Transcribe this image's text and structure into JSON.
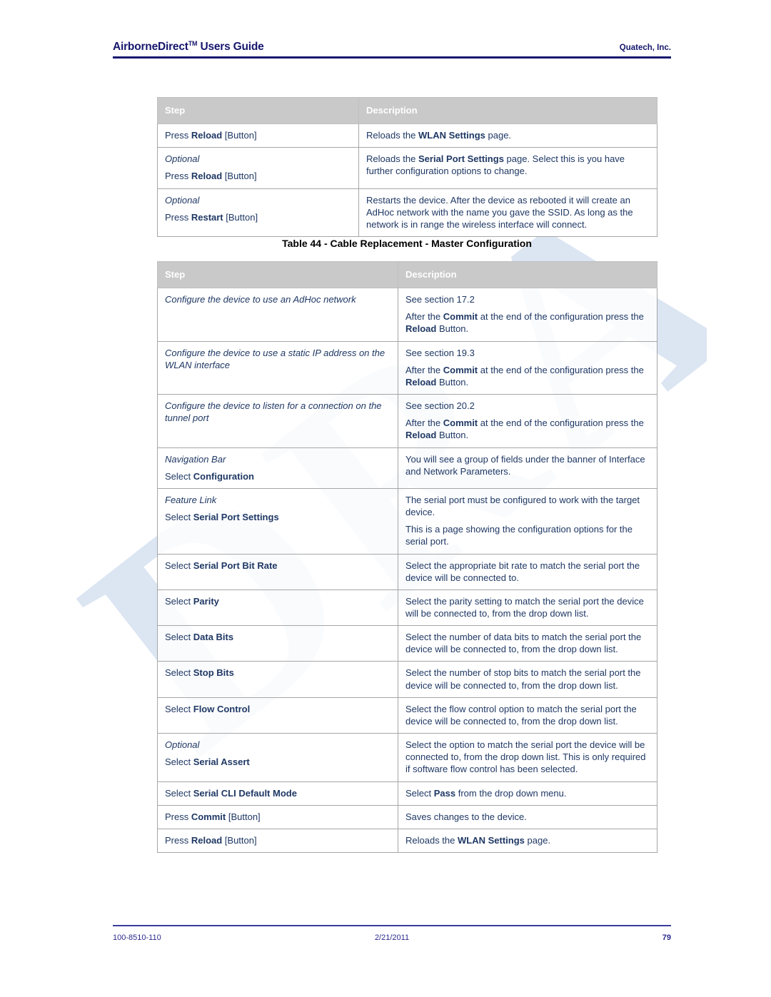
{
  "header": {
    "doc_title": "AirborneDirect",
    "doc_title_tm": "TM",
    "doc_title_rest": " Users Guide",
    "company": "Quatech, Inc."
  },
  "watermark": {
    "text": "DRAFT"
  },
  "footer": {
    "doc_number": "100-8510-110",
    "date": "2/21/2011",
    "page_number": "79"
  },
  "table_top": {
    "columns": [
      "Step",
      "Description"
    ],
    "rows": [
      {
        "step_lines": [
          [
            {
              "t": "Press ",
              "b": false,
              "i": false
            },
            {
              "t": "Reload",
              "b": true,
              "i": false
            },
            {
              "t": " [Button]",
              "b": false,
              "i": false
            }
          ]
        ],
        "desc_lines": [
          [
            {
              "t": "Reloads the ",
              "b": false,
              "i": false
            },
            {
              "t": "WLAN Settings",
              "b": true,
              "i": false
            },
            {
              "t": " page.",
              "b": false,
              "i": false
            }
          ]
        ]
      },
      {
        "step_lines": [
          [
            {
              "t": "Optional",
              "b": false,
              "i": true
            }
          ],
          [
            {
              "t": "Press ",
              "b": false,
              "i": false
            },
            {
              "t": "Reload",
              "b": true,
              "i": false
            },
            {
              "t": " [Button]",
              "b": false,
              "i": false
            }
          ]
        ],
        "desc_lines": [
          [
            {
              "t": "Reloads the ",
              "b": false,
              "i": false
            },
            {
              "t": "Serial Port Settings",
              "b": true,
              "i": false
            },
            {
              "t": " page. Select this is you have further configuration options to change.",
              "b": false,
              "i": false
            }
          ]
        ]
      },
      {
        "step_lines": [
          [
            {
              "t": "Optional",
              "b": false,
              "i": true
            }
          ],
          [
            {
              "t": "Press ",
              "b": false,
              "i": false
            },
            {
              "t": "Restart",
              "b": true,
              "i": false
            },
            {
              "t": " [Button]",
              "b": false,
              "i": false
            }
          ]
        ],
        "desc_lines": [
          [
            {
              "t": "Restarts the device. After the device as rebooted it will create an AdHoc network with the name you gave the SSID. As long as the network is in range the wireless interface will connect.",
              "b": false,
              "i": false
            }
          ]
        ]
      }
    ]
  },
  "table_44": {
    "caption": "Table 44 - Cable Replacement - Master Configuration",
    "columns": [
      "Step",
      "Description"
    ],
    "rows": [
      {
        "step_lines": [
          [
            {
              "t": "Configure the device to use an AdHoc network",
              "b": false,
              "i": true
            }
          ]
        ],
        "desc_lines": [
          [
            {
              "t": "See section 17.2",
              "b": false,
              "i": false
            }
          ],
          [
            {
              "t": "After the ",
              "b": false,
              "i": false
            },
            {
              "t": "Commit",
              "b": true,
              "i": false
            },
            {
              "t": " at the end of the configuration press the ",
              "b": false,
              "i": false
            },
            {
              "t": "Reload",
              "b": true,
              "i": false
            },
            {
              "t": " Button.",
              "b": false,
              "i": false
            }
          ]
        ]
      },
      {
        "step_lines": [
          [
            {
              "t": "Configure the device to use a static IP address on the WLAN interface",
              "b": false,
              "i": true
            }
          ]
        ],
        "desc_lines": [
          [
            {
              "t": "See section 19.3",
              "b": false,
              "i": false
            }
          ],
          [
            {
              "t": "After the ",
              "b": false,
              "i": false
            },
            {
              "t": "Commit",
              "b": true,
              "i": false
            },
            {
              "t": " at the end of the configuration press the ",
              "b": false,
              "i": false
            },
            {
              "t": "Reload",
              "b": true,
              "i": false
            },
            {
              "t": " Button.",
              "b": false,
              "i": false
            }
          ]
        ]
      },
      {
        "step_lines": [
          [
            {
              "t": "Configure the device to listen for a connection on the tunnel port",
              "b": false,
              "i": true
            }
          ]
        ],
        "desc_lines": [
          [
            {
              "t": "See section 20.2",
              "b": false,
              "i": false
            }
          ],
          [
            {
              "t": "After the ",
              "b": false,
              "i": false
            },
            {
              "t": "Commit",
              "b": true,
              "i": false
            },
            {
              "t": " at the end of the configuration press the ",
              "b": false,
              "i": false
            },
            {
              "t": "Reload",
              "b": true,
              "i": false
            },
            {
              "t": " Button.",
              "b": false,
              "i": false
            }
          ]
        ]
      },
      {
        "step_lines": [
          [
            {
              "t": "Navigation Bar",
              "b": false,
              "i": true
            }
          ],
          [
            {
              "t": "Select ",
              "b": false,
              "i": false
            },
            {
              "t": "Configuration",
              "b": true,
              "i": false
            }
          ]
        ],
        "desc_lines": [
          [
            {
              "t": "You will see a group of fields under the banner of Interface and Network Parameters.",
              "b": false,
              "i": false
            }
          ]
        ]
      },
      {
        "step_lines": [
          [
            {
              "t": "Feature Link",
              "b": false,
              "i": true
            }
          ],
          [
            {
              "t": "Select ",
              "b": false,
              "i": false
            },
            {
              "t": "Serial Port Settings",
              "b": true,
              "i": false
            }
          ]
        ],
        "desc_lines": [
          [
            {
              "t": "The serial port must be configured to work with the target device.",
              "b": false,
              "i": false
            }
          ],
          [
            {
              "t": "This is a page showing the configuration options for the serial port.",
              "b": false,
              "i": false
            }
          ]
        ]
      },
      {
        "step_lines": [
          [
            {
              "t": "Select ",
              "b": false,
              "i": false
            },
            {
              "t": "Serial Port Bit Rate",
              "b": true,
              "i": false
            }
          ]
        ],
        "desc_lines": [
          [
            {
              "t": "Select the appropriate bit rate to match the serial port the device will be connected to.",
              "b": false,
              "i": false
            }
          ]
        ]
      },
      {
        "step_lines": [
          [
            {
              "t": "Select ",
              "b": false,
              "i": false
            },
            {
              "t": "Parity",
              "b": true,
              "i": false
            }
          ]
        ],
        "desc_lines": [
          [
            {
              "t": "Select the parity setting to match the serial port the device will be connected to, from the drop down list.",
              "b": false,
              "i": false
            }
          ]
        ]
      },
      {
        "step_lines": [
          [
            {
              "t": "Select ",
              "b": false,
              "i": false
            },
            {
              "t": "Data Bits",
              "b": true,
              "i": false
            }
          ]
        ],
        "desc_lines": [
          [
            {
              "t": "Select the number of data bits to match the serial port the device will be connected to, from the drop down list.",
              "b": false,
              "i": false
            }
          ]
        ]
      },
      {
        "step_lines": [
          [
            {
              "t": "Select ",
              "b": false,
              "i": false
            },
            {
              "t": "Stop Bits",
              "b": true,
              "i": false
            }
          ]
        ],
        "desc_lines": [
          [
            {
              "t": "Select the number of stop bits to match the serial port the device will be connected to, from the drop down list.",
              "b": false,
              "i": false
            }
          ]
        ]
      },
      {
        "step_lines": [
          [
            {
              "t": "Select ",
              "b": false,
              "i": false
            },
            {
              "t": "Flow Control",
              "b": true,
              "i": false
            }
          ]
        ],
        "desc_lines": [
          [
            {
              "t": "Select the flow control option to match the serial port the device will be connected to, from the drop down list.",
              "b": false,
              "i": false
            }
          ]
        ]
      },
      {
        "step_lines": [
          [
            {
              "t": "Optional",
              "b": false,
              "i": true
            }
          ],
          [
            {
              "t": "Select ",
              "b": false,
              "i": false
            },
            {
              "t": "Serial Assert",
              "b": true,
              "i": false
            }
          ]
        ],
        "desc_lines": [
          [
            {
              "t": "Select the option to match the serial port the device will be connected to, from the drop down list. This is only required if software flow control has been selected.",
              "b": false,
              "i": false
            }
          ]
        ]
      },
      {
        "step_lines": [
          [
            {
              "t": "Select ",
              "b": false,
              "i": false
            },
            {
              "t": "Serial CLI Default Mode",
              "b": true,
              "i": false
            }
          ]
        ],
        "desc_lines": [
          [
            {
              "t": "Select ",
              "b": false,
              "i": false
            },
            {
              "t": "Pass",
              "b": true,
              "i": false
            },
            {
              "t": " from the drop down menu.",
              "b": false,
              "i": false
            }
          ]
        ]
      },
      {
        "step_lines": [
          [
            {
              "t": "Press ",
              "b": false,
              "i": false
            },
            {
              "t": "Commit",
              "b": true,
              "i": false
            },
            {
              "t": " [Button]",
              "b": false,
              "i": false
            }
          ]
        ],
        "desc_lines": [
          [
            {
              "t": "Saves changes to the device.",
              "b": false,
              "i": false
            }
          ]
        ]
      },
      {
        "step_lines": [
          [
            {
              "t": "Press ",
              "b": false,
              "i": false
            },
            {
              "t": "Reload",
              "b": true,
              "i": false
            },
            {
              "t": " [Button]",
              "b": false,
              "i": false
            }
          ]
        ],
        "desc_lines": [
          [
            {
              "t": "Reloads the ",
              "b": false,
              "i": false
            },
            {
              "t": "WLAN Settings",
              "b": true,
              "i": false
            },
            {
              "t": " page.",
              "b": false,
              "i": false
            }
          ]
        ]
      }
    ]
  }
}
